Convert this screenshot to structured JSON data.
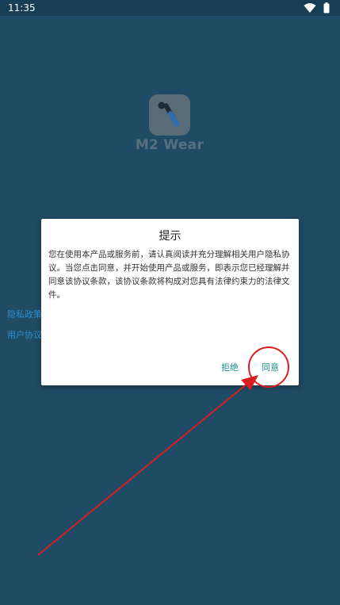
{
  "status_bar": {
    "time": "11:35",
    "wifi_icon": "wifi-icon",
    "battery_icon": "battery-icon"
  },
  "app": {
    "name": "M2 Wear",
    "logo_icon": "m2-wear-logo-icon",
    "background_color": "#204b64",
    "logo_color": "#586b77"
  },
  "dialog": {
    "title": "提示",
    "body": "您在使用本产品或服务前，请认真阅读并充分理解相关用户隐私协议。当您点击同意，并开始使用产品或服务，即表示您已经理解并同意该协议条款，该协议条款将构成对您具有法律约束力的法律文件。",
    "privacy_link": "隐私政策",
    "user_agreement_link": "用户协议",
    "reject_label": "拒绝",
    "agree_label": "同意",
    "link_color": "#2f8fcf",
    "button_color": "#1a8f91"
  },
  "annotation": {
    "color": "#d81e1e",
    "circle_target": "agree-button",
    "arrow_icon": "red-arrow-icon"
  }
}
